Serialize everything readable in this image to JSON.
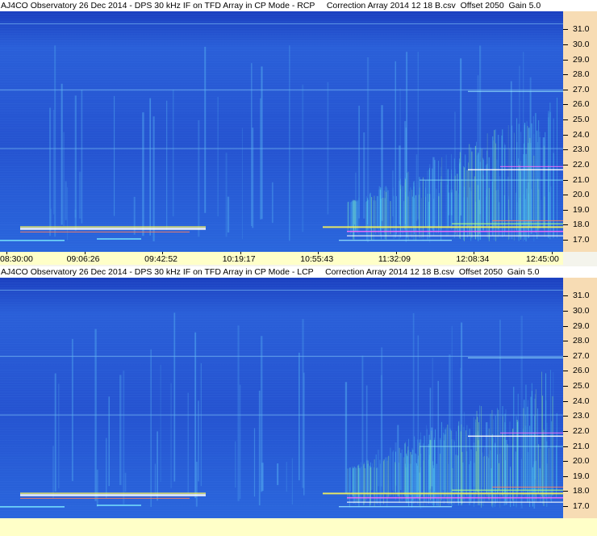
{
  "chart_data": [
    {
      "type": "heatmap",
      "title": "AJ4CO Observatory 26 Dec 2014 - DPS 30 kHz IF on TFD Array in CP Mode - RCP     Correction Array 2014 12 18 B.csv  Offset 2050  Gain 5.0",
      "ylabel": "",
      "xlabel": "",
      "ylim": [
        16.2,
        32.2
      ],
      "y_ticks": [
        "31.0",
        "30.0",
        "29.0",
        "28.0",
        "27.0",
        "26.0",
        "25.0",
        "24.0",
        "23.0",
        "22.0",
        "21.0",
        "20.0",
        "19.0",
        "18.0",
        "17.0"
      ],
      "x_ticks": [
        "08:30:00",
        "09:06:26",
        "09:42:52",
        "10:19:17",
        "10:55:43",
        "11:32:09",
        "12:08:34",
        "12:45:00"
      ],
      "colors": {
        "background": "#1f49c8",
        "low": "#2563e0",
        "mid": "#3fb0f0",
        "high": "#f7f35a",
        "peak": "#ffffff"
      }
    },
    {
      "type": "heatmap",
      "title": "AJ4CO Observatory 26 Dec 2014 - DPS 30 kHz IF on TFD Array in CP Mode - LCP     Correction Array 2014 12 18 B.csv  Offset 2050  Gain 5.0",
      "ylabel": "",
      "xlabel": "",
      "ylim": [
        16.2,
        32.2
      ],
      "y_ticks": [
        "31.0",
        "30.0",
        "29.0",
        "28.0",
        "27.0",
        "26.0",
        "25.0",
        "24.0",
        "23.0",
        "22.0",
        "21.0",
        "20.0",
        "19.0",
        "18.0",
        "17.0"
      ],
      "x_ticks": [],
      "colors": {
        "background": "#1f49c8",
        "low": "#2563e0",
        "mid": "#3fb0f0",
        "high": "#f7f35a",
        "peak": "#ffffff"
      }
    }
  ]
}
